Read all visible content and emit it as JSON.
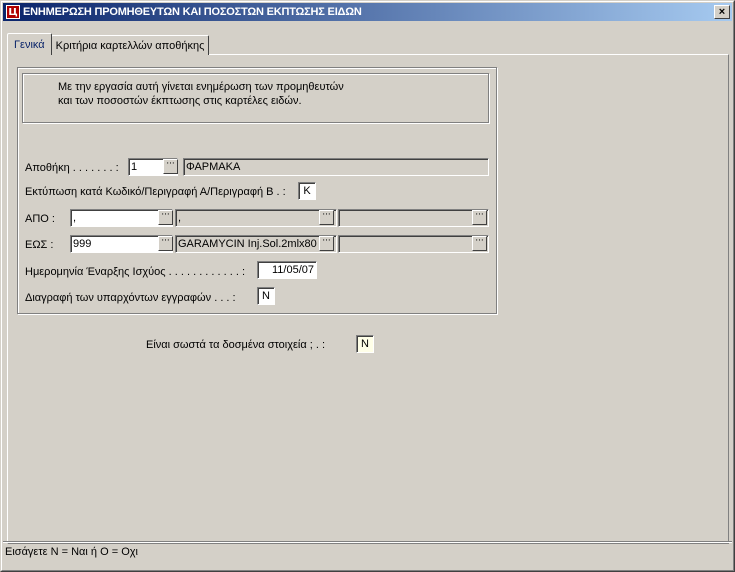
{
  "window": {
    "title": "ΕΝΗΜΕΡΩΣΗ ΠΡΟΜΗΘΕΥΤΩΝ ΚΑΙ ΠΟΣΟΣΤΩΝ ΕΚΠΤΩΣΗΣ ΕΙΔΩΝ",
    "app_icon_letter": "Ц",
    "close_label": "×"
  },
  "tabs": [
    {
      "label": "Γενικά",
      "active": true
    },
    {
      "label": "Κριτήρια καρτελλών αποθήκης",
      "active": false
    }
  ],
  "description": {
    "line1": "Με την εργασία αυτή γίνεται ενημέρωση των προμηθευτών",
    "line2": "και των ποσοστών έκπτωσης στις καρτέλες ειδών."
  },
  "form": {
    "warehouse": {
      "label": "Αποθήκη . . . . . . . :",
      "code": "1",
      "name": "ΦΑΡΜΑΚΑ"
    },
    "print_by": {
      "label": "Εκτύπωση κατά Κωδικό/Περιγραφή Α/Περιγραφή Β . :",
      "value": "K"
    },
    "from": {
      "label": "ΑΠΟ :",
      "code": ",",
      "desc_a": ",",
      "desc_b": ""
    },
    "to": {
      "label": "ΕΩΣ :",
      "code": "999",
      "desc_a": "GARAMYCIN Inj.Sol.2mlx80",
      "desc_b": ""
    },
    "start_date": {
      "label": "Ημερομηνία Έναρξης Ισχύος . . . . . . . . . . . . :",
      "value": "11/05/07"
    },
    "delete_existing": {
      "label": "Διαγραφή των υπαρχόντων εγγραφών . . . :",
      "value": "N"
    }
  },
  "confirm": {
    "label": "Είναι σωστά τα δοσμένα στοιχεία ; .      :",
    "value": "N"
  },
  "lookup_button_glyph": "···",
  "status": {
    "text": "Εισάγετε N = Ναι  ή  O = Οχι"
  },
  "colors": {
    "titlebar_start": "#0a246a",
    "titlebar_end": "#a6caf0",
    "face": "#d4d0c8",
    "app_icon": "#b00000"
  }
}
